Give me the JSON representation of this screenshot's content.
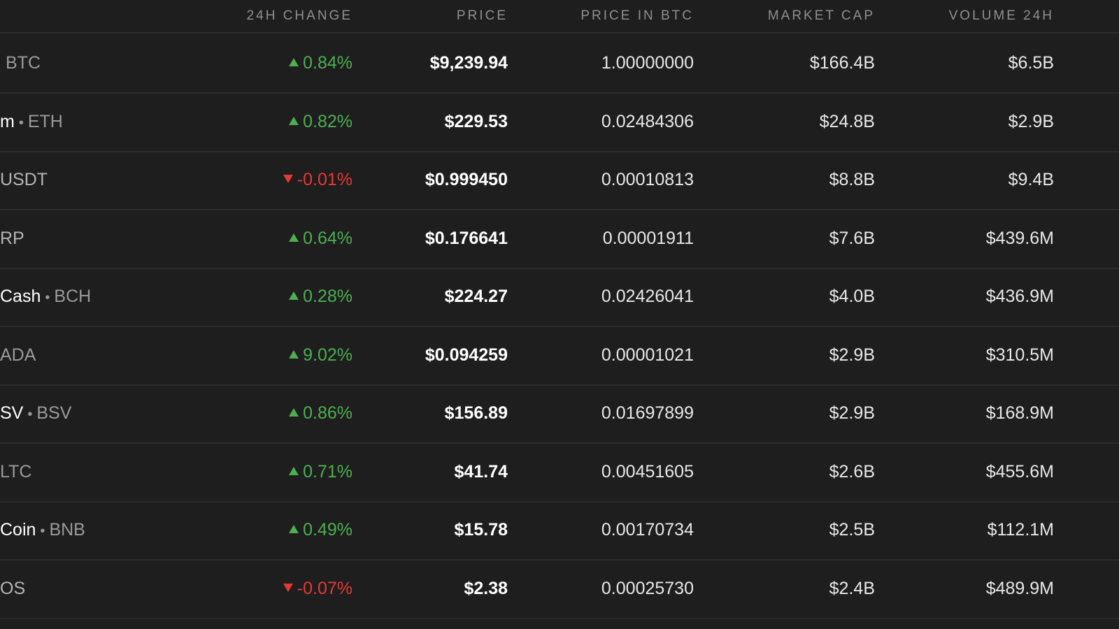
{
  "headers": {
    "change": "24H CHANGE",
    "price": "PRICE",
    "price_btc": "PRICE IN BTC",
    "market_cap": "MARKET CAP",
    "volume": "VOLUME 24H"
  },
  "colors": {
    "positive": "#4caf50",
    "negative": "#e53935",
    "background": "#1e1e1e"
  },
  "rows": [
    {
      "name": "",
      "sym": "BTC",
      "direction": "up",
      "change": "0.84%",
      "price": "$9,239.94",
      "price_btc": "1.00000000",
      "market_cap": "$166.4B",
      "volume": "$6.5B"
    },
    {
      "name": "m",
      "sym": "ETH",
      "direction": "up",
      "change": "0.82%",
      "price": "$229.53",
      "price_btc": "0.02484306",
      "market_cap": "$24.8B",
      "volume": "$2.9B"
    },
    {
      "name": "",
      "sym": "USDT",
      "direction": "down",
      "change": "-0.01%",
      "price": "$0.999450",
      "price_btc": "0.00010813",
      "market_cap": "$8.8B",
      "volume": "$9.4B"
    },
    {
      "name": "",
      "sym": "RP",
      "direction": "up",
      "change": "0.64%",
      "price": "$0.176641",
      "price_btc": "0.00001911",
      "market_cap": "$7.6B",
      "volume": "$439.6M"
    },
    {
      "name": "Cash",
      "sym": "BCH",
      "direction": "up",
      "change": "0.28%",
      "price": "$224.27",
      "price_btc": "0.02426041",
      "market_cap": "$4.0B",
      "volume": "$436.9M"
    },
    {
      "name": "",
      "sym": "ADA",
      "direction": "up",
      "change": "9.02%",
      "price": "$0.094259",
      "price_btc": "0.00001021",
      "market_cap": "$2.9B",
      "volume": "$310.5M"
    },
    {
      "name": "SV",
      "sym": "BSV",
      "direction": "up",
      "change": "0.86%",
      "price": "$156.89",
      "price_btc": "0.01697899",
      "market_cap": "$2.9B",
      "volume": "$168.9M"
    },
    {
      "name": "",
      "sym": "LTC",
      "direction": "up",
      "change": "0.71%",
      "price": "$41.74",
      "price_btc": "0.00451605",
      "market_cap": "$2.6B",
      "volume": "$455.6M"
    },
    {
      "name": "Coin",
      "sym": "BNB",
      "direction": "up",
      "change": "0.49%",
      "price": "$15.78",
      "price_btc": "0.00170734",
      "market_cap": "$2.5B",
      "volume": "$112.1M"
    },
    {
      "name": "",
      "sym": "OS",
      "direction": "down",
      "change": "-0.07%",
      "price": "$2.38",
      "price_btc": "0.00025730",
      "market_cap": "$2.4B",
      "volume": "$489.9M"
    }
  ]
}
